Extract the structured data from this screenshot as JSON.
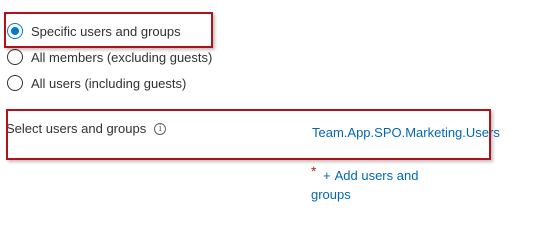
{
  "assignment": {
    "options": [
      {
        "label": "Specific users and groups",
        "selected": true
      },
      {
        "label": "All members (excluding guests)",
        "selected": false
      },
      {
        "label": "All users (including guests)",
        "selected": false
      }
    ]
  },
  "select_field": {
    "label": "Select users and groups",
    "info_icon": "info-icon",
    "selected_value": "Team.App.SPO.Marketing.Users",
    "required_marker": "*",
    "add_prefix": "+",
    "add_label_line1": "Add users and",
    "add_label_line2": "groups"
  },
  "colors": {
    "accent": "#0078d4",
    "link": "#0067b8",
    "highlight": "#b0121b",
    "required": "#a4262c"
  }
}
